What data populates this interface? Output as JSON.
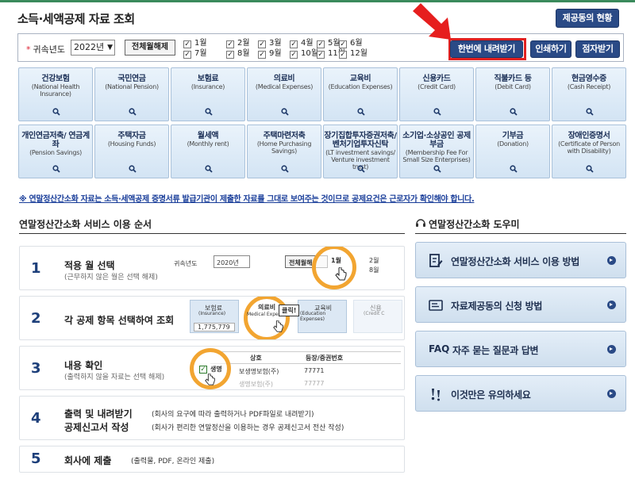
{
  "page": {
    "title": "소득·세액공제 자료 조회"
  },
  "header": {
    "providers_button": "제공동의 현황"
  },
  "filter": {
    "year_label": "귀속년도",
    "year_value": "2022년",
    "clear_all_label": "전체월해제",
    "months": [
      "1월",
      "2월",
      "3월",
      "4월",
      "5월",
      "6월",
      "7월",
      "8월",
      "9월",
      "10월",
      "11월",
      "12월"
    ],
    "download_all_label": "한번에 내려받기",
    "print_label": "인쇄하기",
    "efile_label": "점자받기"
  },
  "categories": [
    {
      "kr": "건강보험",
      "en": "(National Health Insurance)"
    },
    {
      "kr": "국민연금",
      "en": "(National Pension)"
    },
    {
      "kr": "보험료",
      "en": "(Insurance)"
    },
    {
      "kr": "의료비",
      "en": "(Medical Expenses)"
    },
    {
      "kr": "교육비",
      "en": "(Education Expenses)"
    },
    {
      "kr": "신용카드",
      "en": "(Credit Card)"
    },
    {
      "kr": "직불카드 등",
      "en": "(Debit Card)"
    },
    {
      "kr": "현금영수증",
      "en": "(Cash Receipt)"
    },
    {
      "kr": "개인연금저축/ 연금계좌",
      "en": "(Pension Savings)"
    },
    {
      "kr": "주택자금",
      "en": "(Housing Funds)"
    },
    {
      "kr": "월세액",
      "en": "(Monthly rent)"
    },
    {
      "kr": "주택마련저축",
      "en": "(Home Purchasing Savings)"
    },
    {
      "kr": "장기집합투자증권저축/ 벤처기업투자신탁",
      "en": "(LT investment savings/ Venture investment trust)"
    },
    {
      "kr": "소기업·소상공인 공제부금",
      "en": "(Membership Fee For Small Size Enterprises)"
    },
    {
      "kr": "기부금",
      "en": "(Donation)"
    },
    {
      "kr": "장애인증명서",
      "en": "(Certificate of Person with Disability)"
    }
  ],
  "notice": "※ 연말정산간소화 자료는 소득·세액공제 증명서류 발급기관이 제출한 자료를 그대로 보여주는 것이므로 공제요건은 근로자가 확인해야 합니다.",
  "steps_section": {
    "title": "연말정산간소화 서비스 이용 순서",
    "steps": [
      {
        "num": "1",
        "main": "적용 월 선택",
        "sub": "(근무하지 않은 월은 선택 해제)"
      },
      {
        "num": "2",
        "main": "각 공제 항목 선택하여 조회",
        "sub": ""
      },
      {
        "num": "3",
        "main": "내용 확인",
        "sub": "(출력하지 않을 자료는 선택 해제)"
      },
      {
        "num": "4",
        "main": "출력 및 내려받기",
        "main2": "공제신고서 작성",
        "side1": "(회사의 요구에 따라 출력하거나 PDF파일로 내려받기)",
        "side2": "(회사가 편리한 연말정산을 이용하는 경우 공제신고서 전산 작성)"
      },
      {
        "num": "5",
        "main": "회사에 제출",
        "side1": "(출력물, PDF, 온라인 제출)"
      }
    ],
    "illustrations": {
      "s1_year_label": "귀속년도",
      "s1_year_value": "2020년",
      "s1_clear": "전체월해",
      "s1_m1": "1월",
      "s1_m2": "2월",
      "s1_m8": "8월",
      "s2_c1": "보험료",
      "s2_c1_en": "(Insurance)",
      "s2_value": "1,775,779",
      "s2_c2": "의료비",
      "s2_c2_en": "Medical Expen",
      "s2_click": "클릭!",
      "s2_c3": "교육비",
      "s2_c3_en": "(Education Expenses)",
      "s2_c4": "신용",
      "s2_c4_en": "(Credit C",
      "s3_h1": "상호",
      "s3_h2": "등장/증권번호",
      "s3_check": "생명",
      "s3_r1": "보생명보험(주)",
      "s3_r1v": "77771",
      "s3_r2": "생명보험(주)",
      "s3_r2v": "77777"
    }
  },
  "helper_section": {
    "title": "연말정산간소화 도우미",
    "items": [
      {
        "label": "연말정산간소화 서비스 이용 방법"
      },
      {
        "label": "자료제공동의 신청 방법"
      },
      {
        "label": "자주 묻는 질문과 답변",
        "prefix": "FAQ"
      },
      {
        "label": "이것만은 유의하세요"
      }
    ]
  },
  "colors": {
    "navy": "#2a4a86",
    "highlight": "#e02020",
    "accent_ring": "#f2a531",
    "tile": "#d3e4f4"
  }
}
